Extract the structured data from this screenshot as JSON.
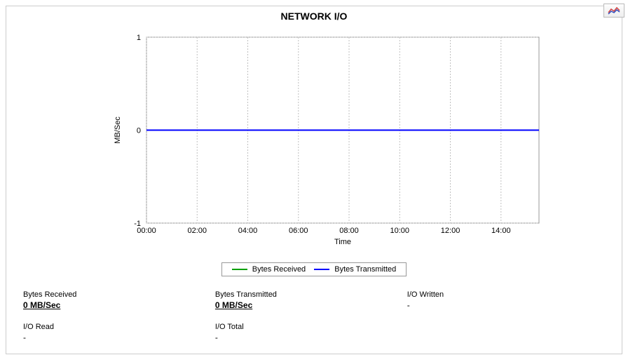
{
  "chart_data": {
    "type": "line",
    "title": "NETWORK I/O",
    "xlabel": "Time",
    "ylabel": "MB/Sec",
    "x_ticks": [
      "00:00",
      "02:00",
      "04:00",
      "06:00",
      "08:00",
      "10:00",
      "12:00",
      "14:00"
    ],
    "y_ticks": [
      -1,
      0,
      1
    ],
    "xlim": [
      "00:00",
      "15:30"
    ],
    "ylim": [
      -1,
      1
    ],
    "series": [
      {
        "name": "Bytes Received",
        "color": "#00A000",
        "x": [
          "00:00",
          "02:00",
          "04:00",
          "06:00",
          "08:00",
          "10:00",
          "12:00",
          "14:00",
          "15:30"
        ],
        "values": [
          0,
          0,
          0,
          0,
          0,
          0,
          0,
          0,
          0
        ]
      },
      {
        "name": "Bytes Transmitted",
        "color": "#0000FF",
        "x": [
          "00:00",
          "02:00",
          "04:00",
          "06:00",
          "08:00",
          "10:00",
          "12:00",
          "14:00",
          "15:30"
        ],
        "values": [
          0,
          0,
          0,
          0,
          0,
          0,
          0,
          0,
          0
        ]
      }
    ],
    "legend": [
      "Bytes Received",
      "Bytes Transmitted"
    ]
  },
  "stats": {
    "bytes_received": {
      "label": "Bytes Received",
      "value": "0 MB/Sec"
    },
    "bytes_transmitted": {
      "label": "Bytes Transmitted",
      "value": "0 MB/Sec"
    },
    "io_written": {
      "label": "I/O Written",
      "value": "-"
    },
    "io_read": {
      "label": "I/O Read",
      "value": "-"
    },
    "io_total": {
      "label": "I/O Total",
      "value": "-"
    }
  },
  "colors": {
    "series_received": "#00A000",
    "series_transmitted": "#0000FF"
  }
}
